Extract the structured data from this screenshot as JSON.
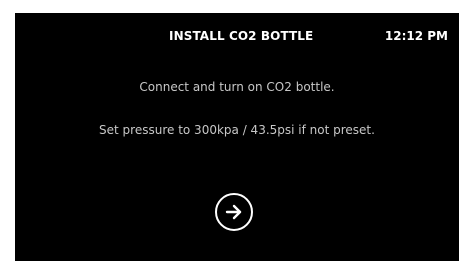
{
  "header": {
    "title": "INSTALL CO2 BOTTLE",
    "time": "12:12 PM"
  },
  "instructions": {
    "line1": "Connect and turn on CO2 bottle.",
    "line2": "Set pressure to 300kpa / 43.5psi if not preset."
  },
  "next_button": {
    "icon": "arrow-right-icon"
  },
  "colors": {
    "background": "#000000",
    "text": "#ffffff",
    "body_text": "#c7c7c7"
  }
}
